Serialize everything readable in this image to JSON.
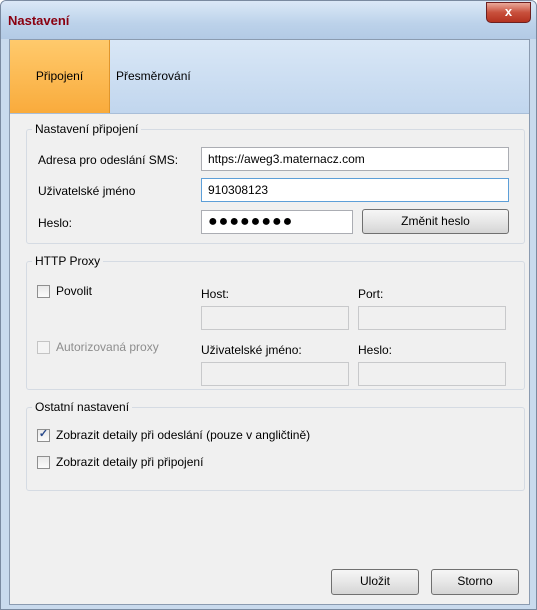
{
  "window": {
    "title": "Nastavení",
    "close_symbol": "x"
  },
  "tabs": [
    {
      "label": "Připojení",
      "active": true
    },
    {
      "label": "Přesměrování",
      "active": false
    }
  ],
  "connection": {
    "legend": "Nastavení připojení",
    "sms_url_label": "Adresa pro odeslání SMS:",
    "sms_url_value": "https://aweg3.maternacz.com",
    "username_label": "Uživatelské jméno",
    "username_value": "910308123",
    "password_label": "Heslo:",
    "password_mask": "●●●●●●●●",
    "change_password_label": "Změnit heslo"
  },
  "proxy": {
    "legend": "HTTP Proxy",
    "enable_label": "Povolit",
    "enable_checked": false,
    "host_label": "Host:",
    "port_label": "Port:",
    "auth_label": "Autorizovaná proxy",
    "auth_checked": false,
    "username_label": "Uživatelské jméno:",
    "password_label": "Heslo:"
  },
  "other": {
    "legend": "Ostatní nastavení",
    "details_send_label": "Zobrazit detaily při odeslání (pouze v angličtině)",
    "details_send_checked": true,
    "details_connect_label": "Zobrazit detaily při připojení",
    "details_connect_checked": false,
    "check_mark": "✓"
  },
  "footer": {
    "save_label": "Uložit",
    "cancel_label": "Storno"
  }
}
